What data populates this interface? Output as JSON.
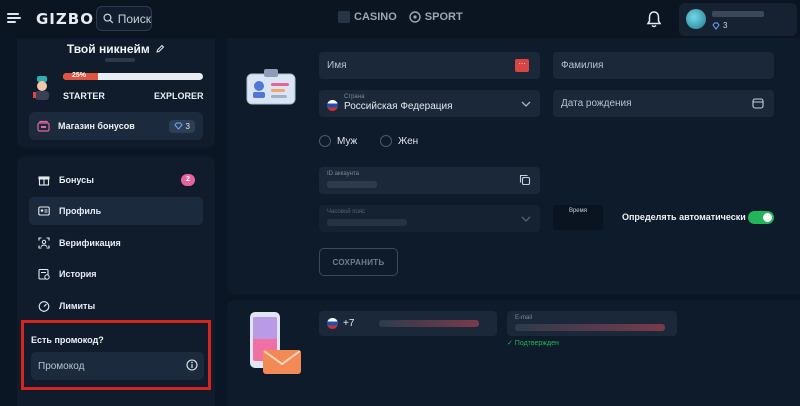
{
  "header": {
    "logo": "GIZBO",
    "search_label": "Поиск",
    "nav": [
      "CASINO",
      "SPORT"
    ],
    "user_gems": "3"
  },
  "profile": {
    "nickname": "Твой никнейм",
    "progress_label": "25%",
    "progress_fraction": 0.25,
    "tier_current": "STARTER",
    "tier_next": "EXPLORER",
    "shop_label": "Магазин бонусов",
    "shop_gems": "3"
  },
  "menu": {
    "items": [
      {
        "label": "Бонусы",
        "icon": "gift-icon",
        "badge": "2"
      },
      {
        "label": "Профиль",
        "icon": "id-card-icon",
        "badge": ""
      },
      {
        "label": "Верификация",
        "icon": "verification-icon",
        "badge": ""
      },
      {
        "label": "История",
        "icon": "history-icon",
        "badge": ""
      },
      {
        "label": "Лимиты",
        "icon": "gauge-icon",
        "badge": ""
      }
    ]
  },
  "promo": {
    "title": "Есть промокод?",
    "placeholder": "Промокод"
  },
  "form": {
    "first_name_placeholder": "Имя",
    "last_name_placeholder": "Фамилия",
    "country_label": "Страна",
    "country_value": "Российская Федерация",
    "birthdate_placeholder": "Дата рождения",
    "gender_male": "Муж",
    "gender_female": "Жен",
    "account_id_label": "ID аккаунта",
    "timezone_label": "Часовой пояс",
    "time_label": "Время",
    "auto_detect_label": "Определять автоматически",
    "auto_detect_on": true,
    "save_label": "СОХРАНИТЬ"
  },
  "contacts": {
    "phone_prefix": "+7",
    "email_label": "E-mail",
    "email_status": "✓ Подтвержден"
  },
  "colors": {
    "background": "#0a1624",
    "panel": "#101c2b",
    "field": "#1a2839",
    "progress": "#e0533f",
    "badge_pink": "#e5639f",
    "toggle_green": "#21b55a",
    "highlight_red": "#d4261f"
  }
}
